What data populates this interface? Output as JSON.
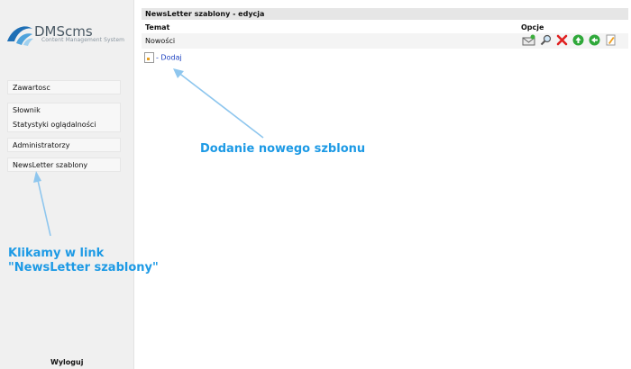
{
  "logo": {
    "name": "DMScms",
    "subtitle": "Content Management System"
  },
  "sidebar": {
    "items": [
      {
        "label": "Zawartosc"
      },
      {
        "label": "Słownik"
      },
      {
        "label": "Statystyki oglądalności"
      },
      {
        "label": "Administratorzy"
      },
      {
        "label": "NewsLetter szablony"
      }
    ],
    "logout_label": "Wyloguj"
  },
  "main": {
    "title": "NewsLetter szablony - edycja",
    "columns": {
      "temat": "Temat",
      "opcje": "Opcje"
    },
    "rows": [
      {
        "temat": "Nowości",
        "options": [
          "send-mail-icon",
          "preview-icon",
          "delete-icon",
          "move-up-icon",
          "move-down-icon",
          "edit-icon"
        ]
      }
    ],
    "add_link": "- Dodaj"
  },
  "annotations": {
    "new_template": "Dodanie nowego szblonu",
    "click_line1": "Klikamy w link",
    "click_line2": "\"NewsLetter szablony\""
  },
  "colors": {
    "annotation": "#1d9ae5",
    "link": "#1a3fc0",
    "sidebar_bg": "#f0f0f0"
  }
}
